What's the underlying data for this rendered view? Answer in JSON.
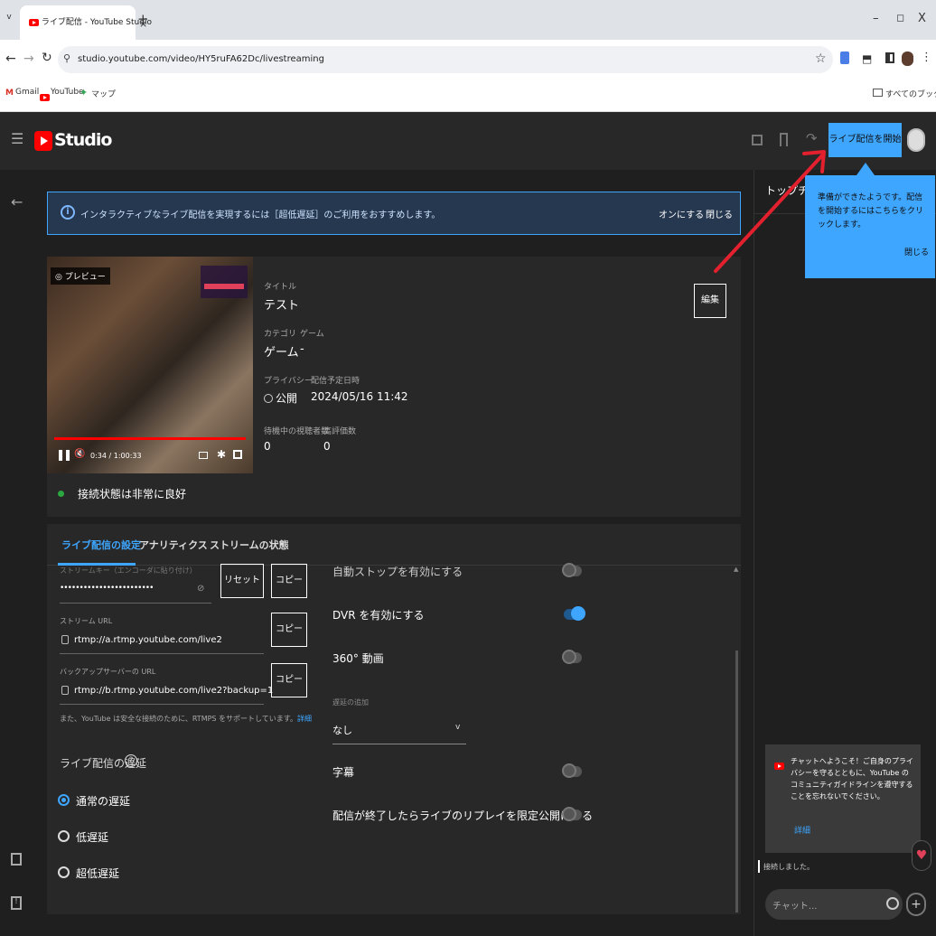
{
  "browser": {
    "tab_list_label": "v",
    "tab_title": "ライブ配信 - YouTube Studio",
    "tab_close": "×",
    "new_tab": "+",
    "window_min": "–",
    "window_max": "◻",
    "window_close": "X",
    "back": "←",
    "forward": "→",
    "reload": "↻",
    "site_info": "⚲",
    "url": "studio.youtube.com/video/HY5ruFA62Dc/livestreaming",
    "star": "☆",
    "extension": "⬒",
    "menu": "⋮",
    "bookmarks": {
      "gmail_icon": "M",
      "gmail": "Gmail",
      "youtube": "YouTube",
      "map_icon": "✦",
      "map": "マップ",
      "all": "すべてのブックマーク"
    }
  },
  "studio": {
    "menu_icon": "☰",
    "logo_text": "Studio",
    "share_icon": "↷",
    "go_live_button": "ライブ配信を開始"
  },
  "rail": {
    "back": "←"
  },
  "banner": {
    "icon": "i",
    "text": "インタラクティブなライブ配信を実現するには［超低遅延］のご利用をおすすめします。",
    "on_button": "オンにする",
    "close_button": "閉じる"
  },
  "preview": {
    "label": "◎ プレビュー",
    "play_pause": "❚❚",
    "mute": "🔇",
    "time": "0:34 / 1:00:33",
    "settings": "✱",
    "progress": 0.99
  },
  "stream_info": {
    "title_label": "タイトル",
    "title": "テスト",
    "category_label": "カテゴリ",
    "category": "ゲーム",
    "game_label": "ゲーム",
    "game": "-",
    "privacy_label": "プライバシー",
    "privacy": "公開",
    "scheduled_label": "配信予定日時",
    "scheduled": "2024/05/16 11:42",
    "waiting_label": "待機中の視聴者数",
    "waiting": "0",
    "rating_label": "高評価数",
    "rating": "0",
    "edit_button": "編集",
    "connection": "接続状態は非常に良好"
  },
  "settings": {
    "tabs": [
      "ライブ配信の設定",
      "アナリティクス",
      "ストリームの状態"
    ],
    "stream_key_label": "ストリームキー（エンコーダに貼り付け）",
    "stream_key_value": "••••••••••••••••••••••••",
    "reset_button": "リセット",
    "copy_button": "コピー",
    "stream_url_label": "ストリーム URL",
    "stream_url": "rtmp://a.rtmp.youtube.com/live2",
    "backup_url_label": "バックアップサーバーの URL",
    "backup_url": "rtmp://b.rtmp.youtube.com/live2?backup=1",
    "rtmps_note": "また、YouTube は安全な接続のために、RTMPS をサポートしています。",
    "rtmps_link": "詳細",
    "latency_title": "ライブ配信の遅延",
    "latency_help": "?",
    "latency_options": [
      "通常の遅延",
      "低遅延",
      "超低遅延"
    ],
    "latency_selected": 0,
    "auto_stop": "自動ストップを有効にする",
    "dvr": "DVR を有効にする",
    "vr360": "360° 動画",
    "delay_label": "遅延の追加",
    "delay_value": "なし",
    "delay_chevron": "v",
    "captions": "字幕",
    "replay_unlisted": "配信が終了したらライブのリプレイを限定公開にする",
    "scroll_up": "▲",
    "toggles": {
      "auto_stop": false,
      "dvr": true,
      "vr360": false,
      "captions": false,
      "replay_unlisted": false
    }
  },
  "chat": {
    "top_chat": "トップチャット",
    "welcome": "チャットへようこそ！ご自身のプライバシーを守るとともに、YouTube のコミュニティガイドラインを遵守することを忘れないでください。",
    "welcome_link": "詳細",
    "heart": "♥",
    "connected": "接続しました。",
    "input_placeholder": "チャット...",
    "send": "+"
  },
  "tooltip": {
    "text": "準備ができたようです。配信を開始するにはこちらをクリックします。",
    "close": "閉じる"
  },
  "colors": {
    "accent": "#3ea6ff",
    "youtube_red": "#ff0000",
    "status_good": "#2ba640",
    "annotation": "#e3202d"
  }
}
